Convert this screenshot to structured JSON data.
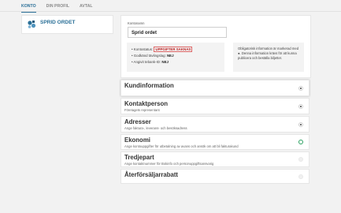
{
  "tabs": [
    "KONTO",
    "DIN PROFIL",
    "AVTAL"
  ],
  "account": {
    "name": "SPRID ORDET"
  },
  "form": {
    "label": "Kontonamn",
    "value": "Sprid ordet"
  },
  "status": {
    "contact_label": "• Kontostatus:",
    "contact_value": "UPPGIFTER SAKNAS",
    "terms_label": "• Godkänd tävlingslag:",
    "terms_value": "NEJ",
    "bank_label": "• Angivit tebank-ID:",
    "bank_value": "NEJ"
  },
  "note": "Obligatorisk information är markerad med ●. Denna information krävs för att kunna publicera och beställa biljetter.",
  "sections": [
    {
      "title": "Kundinformation",
      "subtitle": "",
      "state": "done"
    },
    {
      "title": "Kontaktperson",
      "subtitle": "Företagets representant",
      "state": "done"
    },
    {
      "title": "Adresser",
      "subtitle": "Ange faktura-, leverans- och besöksadress",
      "state": "done"
    },
    {
      "title": "Ekonomi",
      "subtitle": "Ange kontouppgifter för utbetalning av avans och ansök om att bli fakturakund",
      "state": "open"
    },
    {
      "title": "Tredjepart",
      "subtitle": "Ange kontaktnummer för Bokinfo och personuppgiftsansvarig",
      "state": "empty"
    },
    {
      "title": "Återförsäljarrabatt",
      "subtitle": "",
      "state": "empty"
    }
  ],
  "colors": {
    "accent": "#2a6f97",
    "open": "#2aa060",
    "warn": "#b22222"
  }
}
